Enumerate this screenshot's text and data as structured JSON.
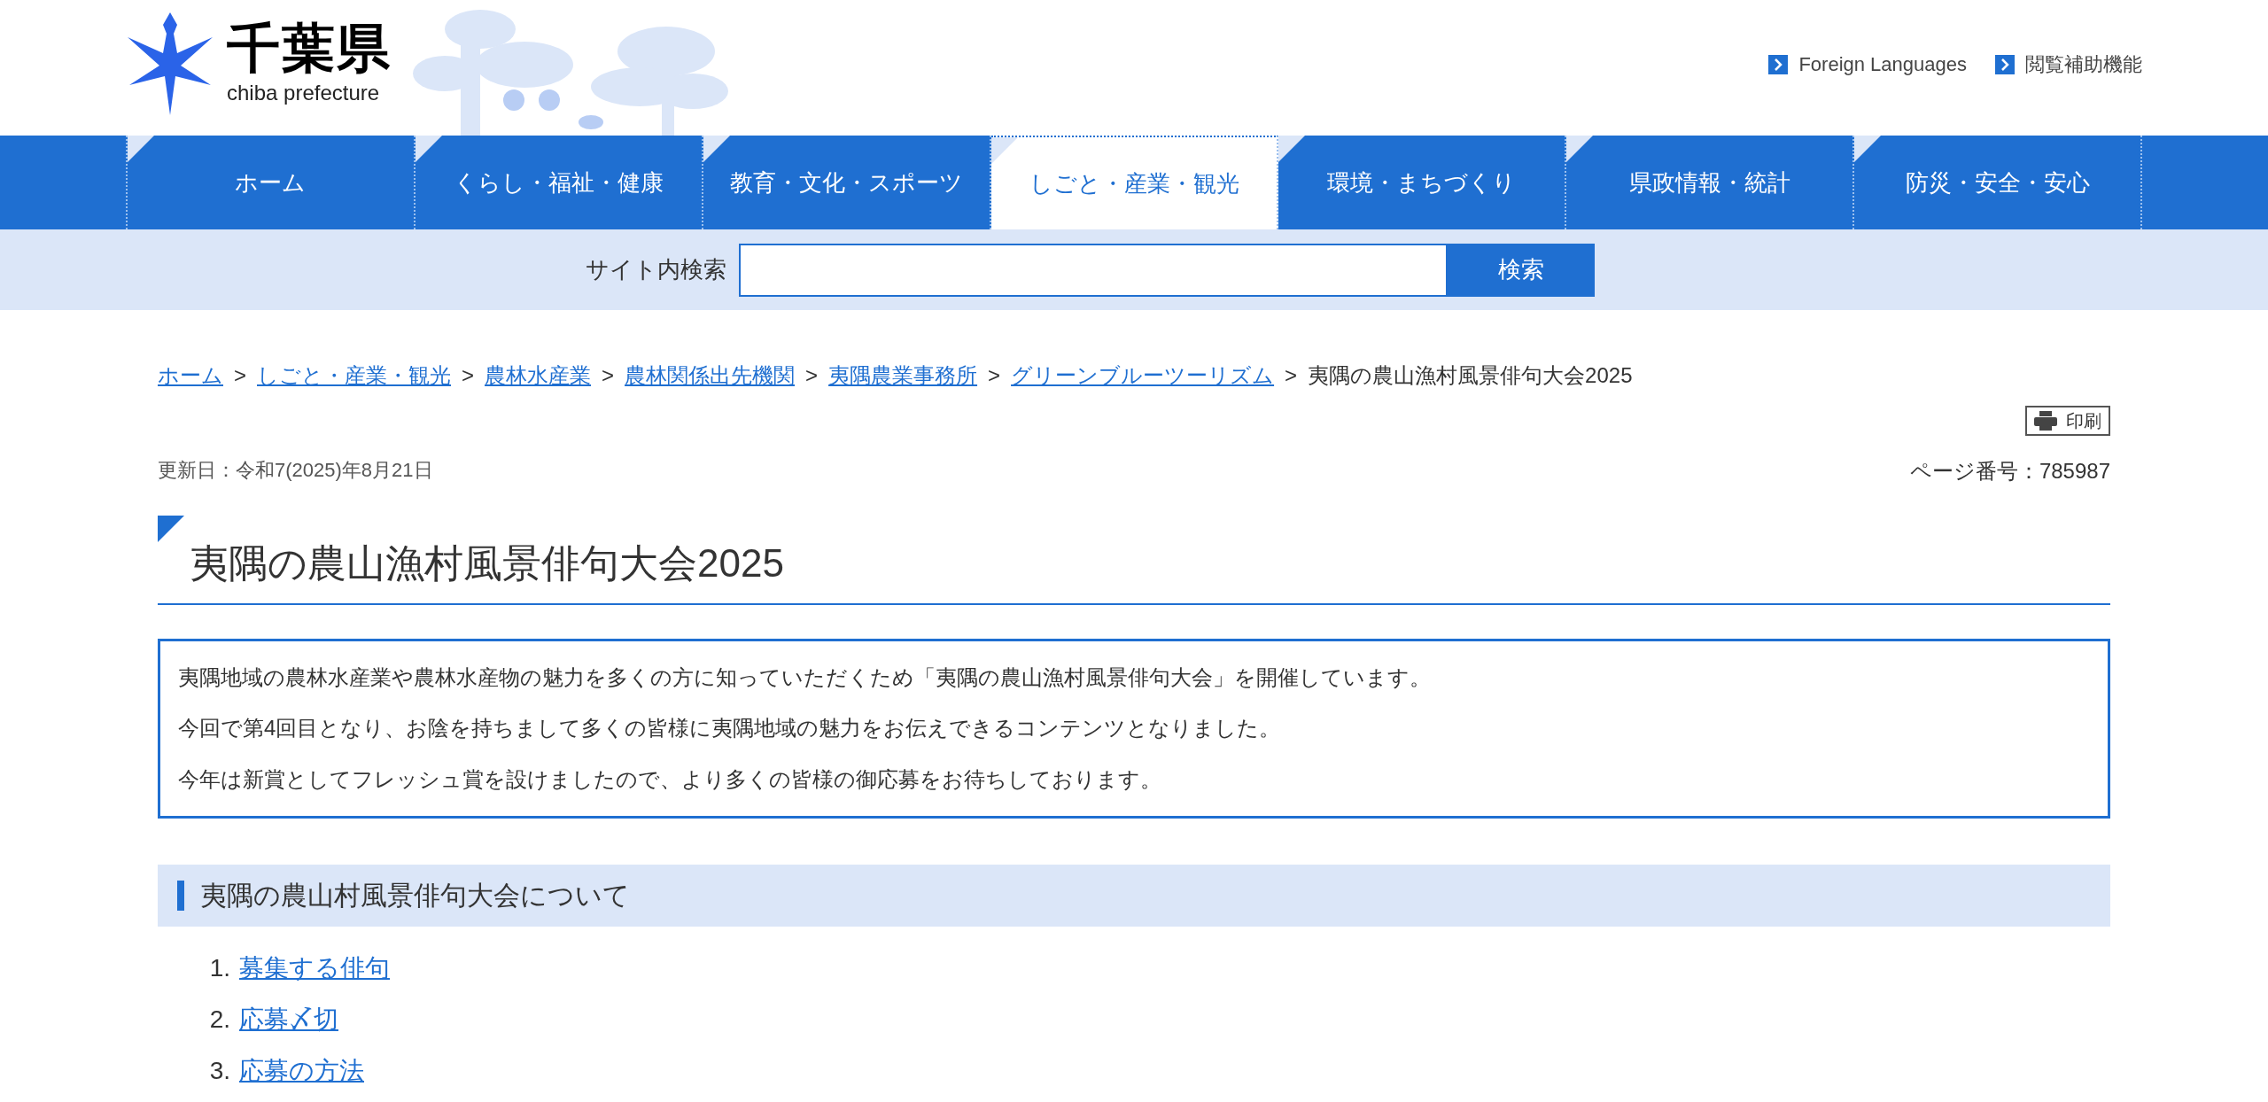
{
  "header": {
    "logo_title": "千葉県",
    "logo_subtitle": "chiba prefecture",
    "links": [
      {
        "label": "Foreign Languages"
      },
      {
        "label": "閲覧補助機能"
      }
    ]
  },
  "nav": [
    {
      "label": "ホーム",
      "selected": false
    },
    {
      "label": "くらし・福祉・健康",
      "selected": false
    },
    {
      "label": "教育・文化・スポーツ",
      "selected": false
    },
    {
      "label": "しごと・産業・観光",
      "selected": true
    },
    {
      "label": "環境・まちづくり",
      "selected": false
    },
    {
      "label": "県政情報・統計",
      "selected": false
    },
    {
      "label": "防災・安全・安心",
      "selected": false
    }
  ],
  "search": {
    "label": "サイト内検索",
    "button": "検索"
  },
  "breadcrumb": {
    "separator": ">",
    "links": [
      "ホーム",
      "しごと・産業・観光",
      "農林水産業",
      "農林関係出先機関",
      "夷隅農業事務所",
      "グリーンブルーツーリズム"
    ],
    "current": "夷隅の農山漁村風景俳句大会2025"
  },
  "print_button": "印刷",
  "updated": "更新日：令和7(2025)年8月21日",
  "page_number": "ページ番号：785987",
  "title": "夷隅の農山漁村風景俳句大会2025",
  "intro": [
    "夷隅地域の農林水産業や農林水産物の魅力を多くの方に知っていただくため「夷隅の農山漁村風景俳句大会」を開催しています。",
    "今回で第4回目となり、お陰を持ちまして多くの皆様に夷隅地域の魅力をお伝えできるコンテンツとなりました。",
    "今年は新賞としてフレッシュ賞を設けましたので、より多くの皆様の御応募をお待ちしております。"
  ],
  "section": {
    "heading": "夷隅の農山村風景俳句大会について",
    "items": [
      {
        "number": "1.",
        "label": "募集する俳句"
      },
      {
        "number": "2.",
        "label": "応募〆切"
      },
      {
        "number": "3.",
        "label": "応募の方法"
      }
    ]
  }
}
